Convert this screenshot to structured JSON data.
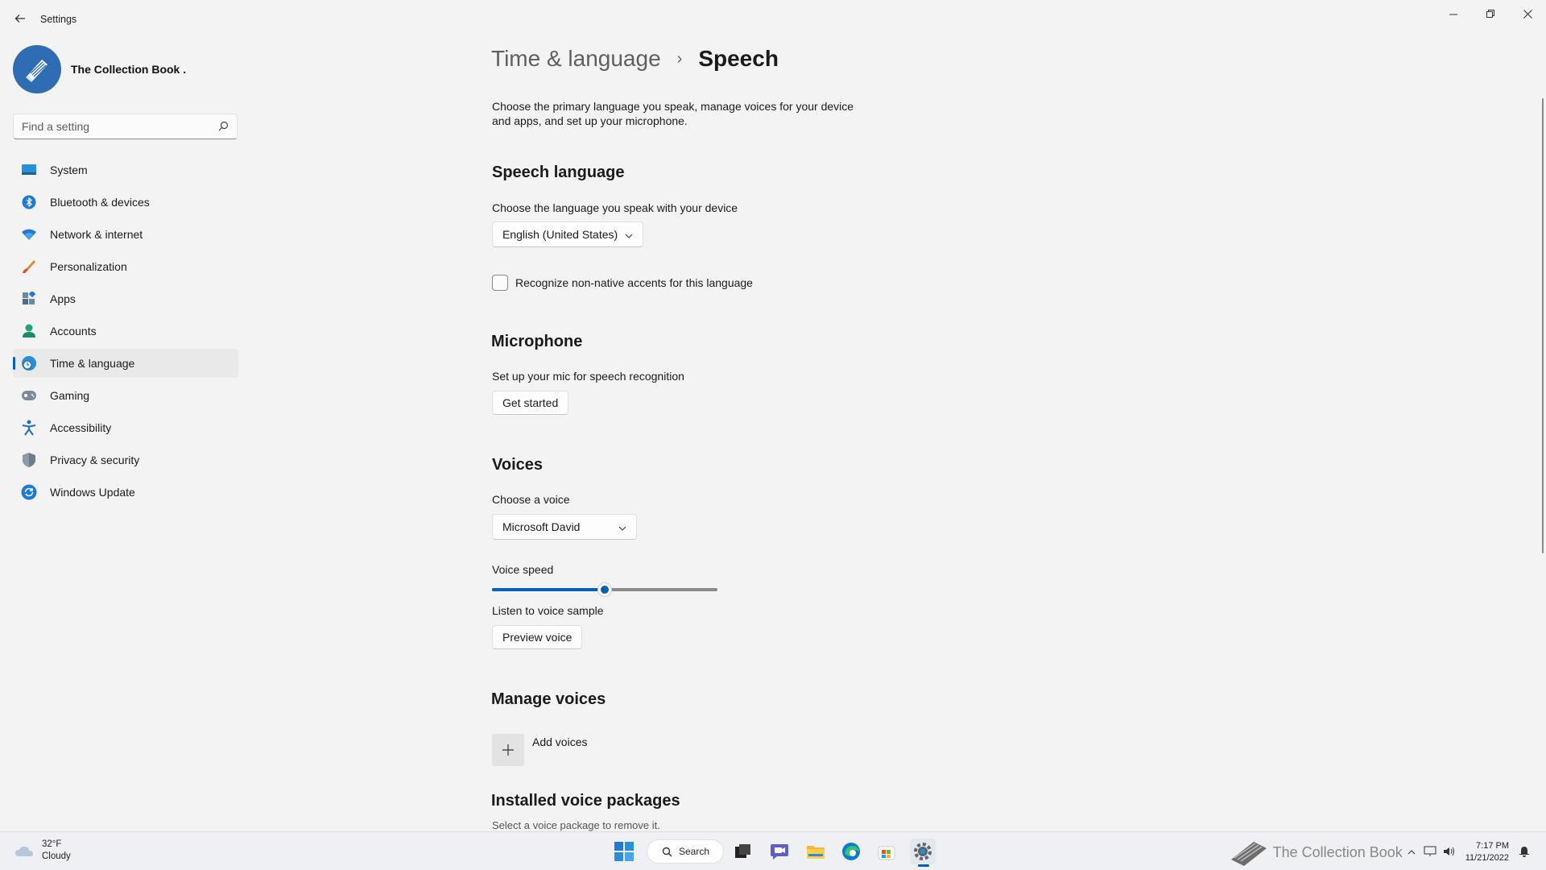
{
  "window": {
    "title": "Settings"
  },
  "profile": {
    "name": "The Collection Book ."
  },
  "search": {
    "placeholder": "Find a setting"
  },
  "sidebar": {
    "items": [
      {
        "label": "System",
        "icon": "monitor-icon"
      },
      {
        "label": "Bluetooth & devices",
        "icon": "bluetooth-icon"
      },
      {
        "label": "Network & internet",
        "icon": "wifi-icon"
      },
      {
        "label": "Personalization",
        "icon": "brush-icon"
      },
      {
        "label": "Apps",
        "icon": "apps-icon"
      },
      {
        "label": "Accounts",
        "icon": "person-icon"
      },
      {
        "label": "Time & language",
        "icon": "globe-clock-icon",
        "active": true
      },
      {
        "label": "Gaming",
        "icon": "gamepad-icon"
      },
      {
        "label": "Accessibility",
        "icon": "accessibility-icon"
      },
      {
        "label": "Privacy & security",
        "icon": "shield-icon"
      },
      {
        "label": "Windows Update",
        "icon": "update-icon"
      }
    ]
  },
  "breadcrumb": {
    "parent": "Time & language",
    "separator": "›",
    "current": "Speech"
  },
  "page": {
    "description": "Choose the primary language you speak, manage voices for your device and apps, and set up your microphone.",
    "speech_language": {
      "heading": "Speech language",
      "label": "Choose the language you speak with your device",
      "selected": "English (United States)",
      "checkbox_label": "Recognize non-native accents for this language",
      "checkbox_checked": false
    },
    "microphone": {
      "heading": "Microphone",
      "label": "Set up your mic for speech recognition",
      "button": "Get started"
    },
    "voices": {
      "heading": "Voices",
      "choose_label": "Choose a voice",
      "selected": "Microsoft David",
      "speed_label": "Voice speed",
      "speed_fraction": 0.5,
      "sample_label": "Listen to voice sample",
      "preview_button": "Preview voice"
    },
    "manage": {
      "heading": "Manage voices",
      "add_label": "Add voices"
    },
    "installed": {
      "heading": "Installed voice packages",
      "description": "Select a voice package to remove it."
    }
  },
  "taskbar": {
    "weather_temp": "32°F",
    "weather_desc": "Cloudy",
    "search_label": "Search",
    "time": "7:17 PM",
    "date": "11/21/2022",
    "watermark": "The Collection Book"
  },
  "colors": {
    "accent": "#005fb8",
    "background": "#f3f3f3"
  }
}
